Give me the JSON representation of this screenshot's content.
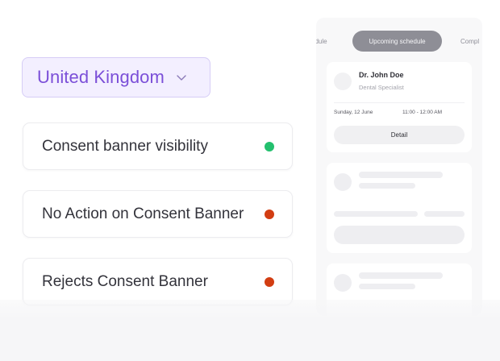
{
  "country_select": {
    "label": "United Kingdom",
    "chevron_icon": "chevron-down-icon",
    "text_color": "#7b4fd8",
    "background": "#f3efff"
  },
  "consent_items": [
    {
      "label": "Consent banner visibility",
      "status": "success",
      "dot_color": "#23c06e"
    },
    {
      "label": "No Action on Consent Banner",
      "status": "error",
      "dot_color": "#d23d12"
    },
    {
      "label": "Rejects Consent Banner",
      "status": "error",
      "dot_color": "#d23d12"
    }
  ],
  "schedule": {
    "tabs": {
      "prev": "edule",
      "active": "Upcoming schedule",
      "next": "Compl"
    },
    "appointment": {
      "doctor_name": "Dr. John Doe",
      "doctor_role": "Dental Specialist",
      "date": "Sunday, 12 June",
      "time": "11:00 - 12:00 AM",
      "detail_label": "Detail"
    }
  }
}
